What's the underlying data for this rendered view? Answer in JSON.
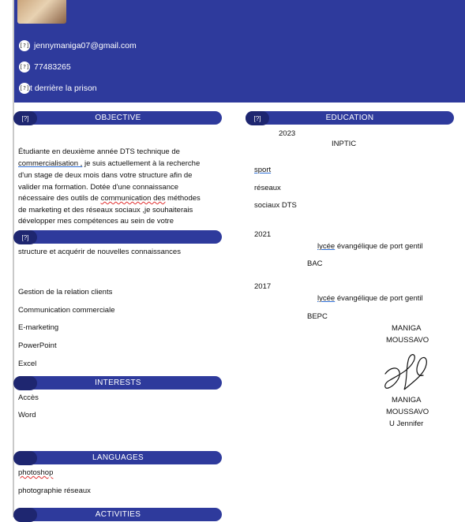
{
  "header": {
    "email": "jennymaniga07@gmail.com",
    "phone": "77483265",
    "address": "t derrière  la prison",
    "icon_glyph": "[?]"
  },
  "sections": {
    "objective": "OBJECTIVE",
    "education": "EDUCATION",
    "interests": "INTERESTS",
    "languages": "LANGUAGES",
    "activities": "ACTIVITIES"
  },
  "objective": {
    "line1": "Étudiante en deuxième année DTS technique de",
    "line2_a": "commercialisation ,",
    "line2_b": " je suis actuellement à la recherche",
    "line3": "d'un stage de deux mois dans votre structure afin de",
    "line4": "valider ma formation. Dotée d'une connaissance",
    "line5_a": "nécessaire des outils de ",
    "line5_b": "communication des",
    "line5_c": " méthodes",
    "line6": "de marketing et des réseaux sociaux ,je souhaiterais",
    "line7": "développer mes compétences au sein de votre",
    "line8": "structure et acquérir de nouvelles connaissances"
  },
  "skills": [
    "Gestion de la relation clients",
    "Communication commerciale",
    "E-marketing",
    "PowerPoint",
    "Excel"
  ],
  "interests": [
    "Accès",
    "Word"
  ],
  "languages": [
    "photoshop",
    "photographie réseaux"
  ],
  "education": [
    {
      "year": "2023",
      "school": "INPTIC",
      "details": [
        "sport",
        "réseaux",
        "sociaux DTS"
      ]
    },
    {
      "year": "2021",
      "school_a": "lycée",
      "school_b": " évangélique de port gentil",
      "diploma": "BAC"
    },
    {
      "year": "2017",
      "school_a": "lycée",
      "school_b": " évangélique de port gentil",
      "diploma": "BEPC"
    }
  ],
  "signature": {
    "name_top_1": "MANIGA",
    "name_top_2": "MOUSSAVO",
    "name_bottom_1": "MANIGA",
    "name_bottom_2": "MOUSSAVO",
    "name_bottom_3": "U Jennifer"
  }
}
